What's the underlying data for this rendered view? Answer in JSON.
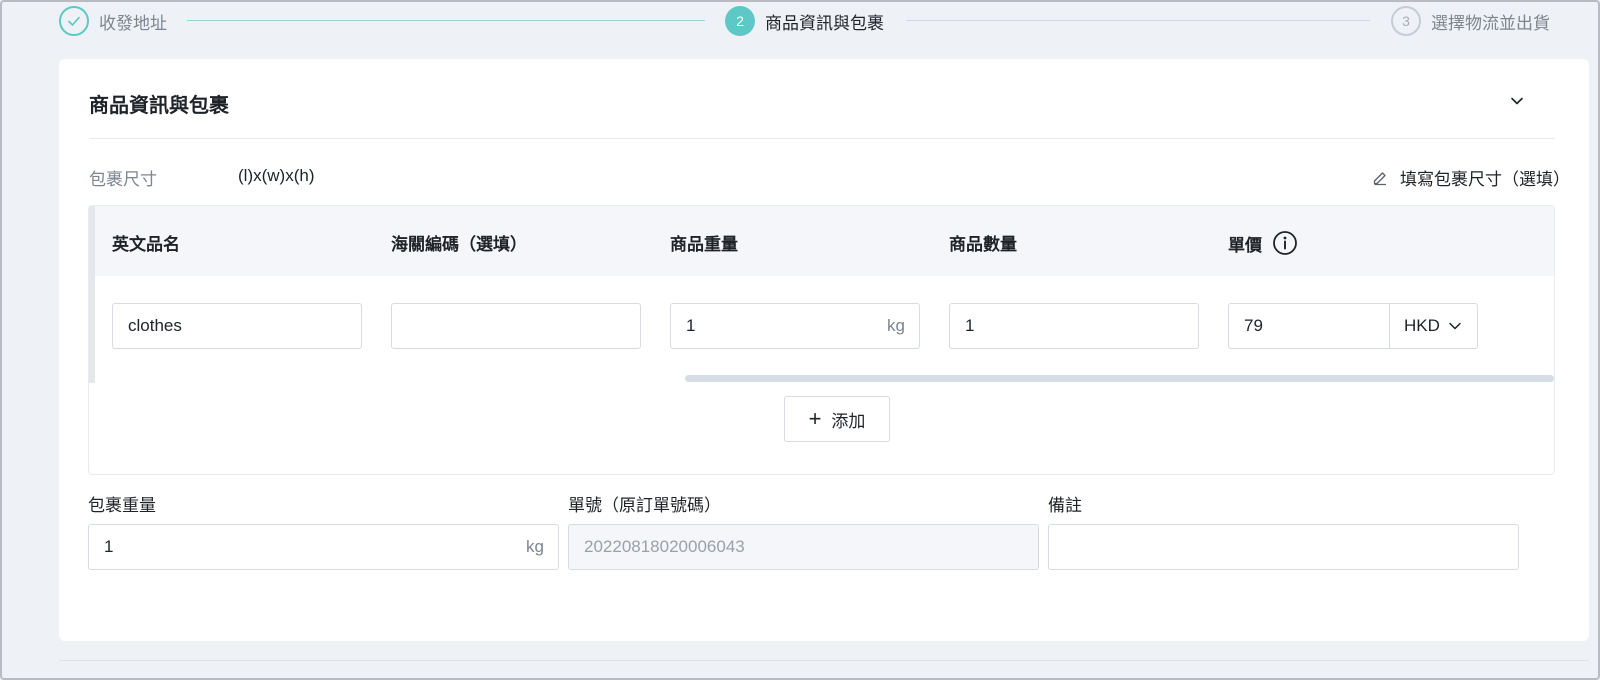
{
  "stepper": {
    "steps": [
      {
        "number": "✓",
        "label": "收發地址",
        "state": "done"
      },
      {
        "number": "2",
        "label": "商品資訊與包裹",
        "state": "active"
      },
      {
        "number": "3",
        "label": "選擇物流並出貨",
        "state": "pending"
      }
    ]
  },
  "card": {
    "title": "商品資訊與包裹",
    "package_size": {
      "label": "包裹尺寸",
      "value": "(l)x(w)x(h)",
      "edit_label": "填寫包裹尺寸（選填）"
    },
    "items_table": {
      "headers": {
        "name": "英文品名",
        "hs_code": "海關編碼（選填）",
        "weight": "商品重量",
        "quantity": "商品數量",
        "price": "單價"
      },
      "rows": [
        {
          "name": "clothes",
          "hs_code": "",
          "weight": "1",
          "weight_unit": "kg",
          "quantity": "1",
          "price": "79",
          "currency": "HKD"
        }
      ],
      "add_label": "添加"
    },
    "package_weight": {
      "label": "包裹重量",
      "value": "1",
      "unit": "kg"
    },
    "order_number": {
      "label": "單號（原訂單號碼）",
      "value": "20220818020006043"
    },
    "remarks": {
      "label": "備註",
      "value": ""
    }
  },
  "colors": {
    "accent": "#5dc8c6",
    "muted": "#7d858f",
    "border": "#d7dce2"
  }
}
